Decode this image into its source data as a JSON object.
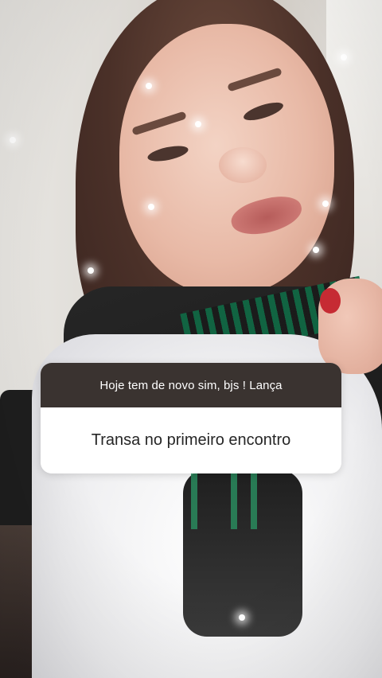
{
  "story": {
    "question_box": {
      "prompt": "Hoje tem de novo sim, bjs ! Lança",
      "answer": "Transa no primeiro encontro"
    },
    "colors": {
      "header_bg": "#3a3330",
      "body_bg": "#ffffff",
      "answer_text": "#262626",
      "prompt_text": "#ffffff",
      "nail_polish": "#c62b33",
      "jacket_stripe": "#0f6b45"
    }
  }
}
